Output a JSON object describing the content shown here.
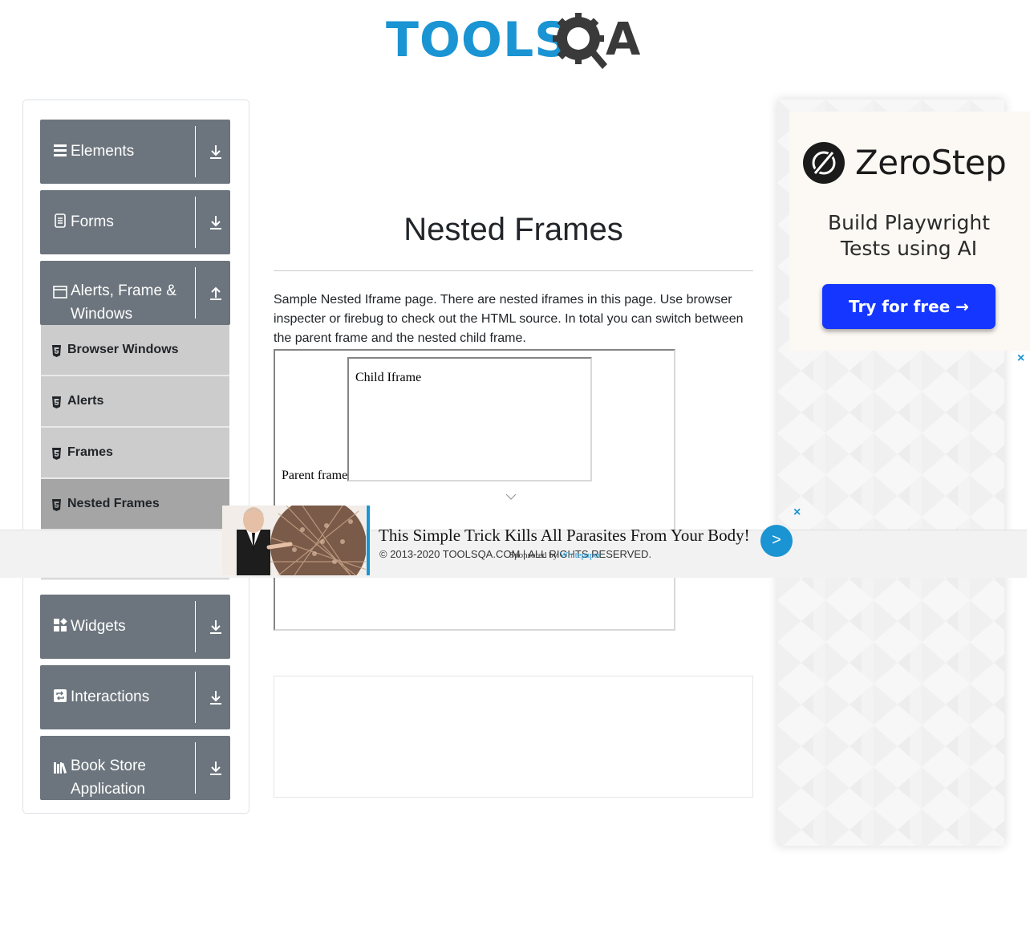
{
  "logo": {
    "text": "TOOLS",
    "suffix": "A"
  },
  "sidebar": {
    "groups": [
      {
        "label": "Elements",
        "icon": "hamburger-icon",
        "arrow": "download"
      },
      {
        "label": "Forms",
        "icon": "document-icon",
        "arrow": "download"
      },
      {
        "label": "Alerts, Frame & Windows",
        "icon": "window-icon",
        "arrow": "upload"
      },
      {
        "label": "Widgets",
        "icon": "widgets-icon",
        "arrow": "download"
      },
      {
        "label": "Interactions",
        "icon": "swap-icon",
        "arrow": "download"
      },
      {
        "label": "Book Store Application",
        "icon": "books-icon",
        "arrow": "download"
      }
    ],
    "subitems": [
      {
        "label": "Browser Windows"
      },
      {
        "label": "Alerts"
      },
      {
        "label": "Frames"
      },
      {
        "label": "Nested Frames"
      }
    ]
  },
  "main": {
    "title": "Nested Frames",
    "description": "Sample Nested Iframe page. There are nested iframes in this page. Use browser inspecter or firebug to check out the HTML source. In total you can switch between the parent frame and the nested child frame.",
    "parent_frame_text": "Parent frame",
    "child_frame_text": "Child Iframe"
  },
  "footer": {
    "text": "© 2013-2020 TOOLSQA.COM | ALL RIGHTS RESERVED."
  },
  "bottom_ad": {
    "title": "This Simple Trick Kills All Parasites From Your Body!",
    "sponsored_prefix": "Sponsored by",
    "sponsor": "Whitepaper",
    "go_label": ">",
    "close_label": "×"
  },
  "right_ad": {
    "brand": "ZeroStep",
    "tagline": "Build Playwright Tests using AI",
    "cta": "Try for free →",
    "close_label": "×"
  },
  "colors": {
    "brand_blue": "#1a94d2",
    "sidebar_gray": "#6c757d",
    "cta_blue": "#1436ff"
  }
}
